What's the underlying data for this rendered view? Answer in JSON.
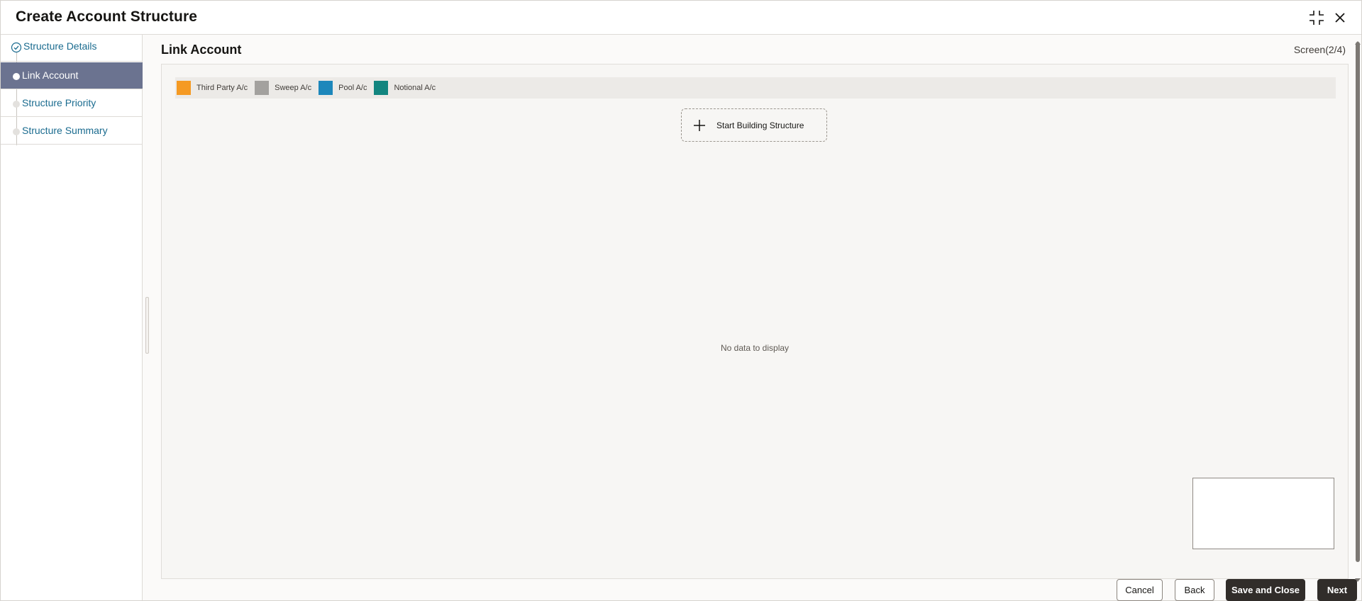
{
  "window": {
    "title": "Create Account Structure"
  },
  "header_icons": {
    "minimize": "minimize-icon",
    "close": "close-icon"
  },
  "sidebar": {
    "steps": [
      {
        "label": "Structure Details",
        "state": "completed"
      },
      {
        "label": "Link Account",
        "state": "active"
      },
      {
        "label": "Structure Priority",
        "state": "pending"
      },
      {
        "label": "Structure Summary",
        "state": "pending"
      }
    ]
  },
  "main": {
    "title": "Link Account",
    "screen_indicator": "Screen(2/4)",
    "legend": [
      {
        "label": "Third Party A/c",
        "color": "#f59a23"
      },
      {
        "label": "Sweep A/c",
        "color": "#a3a19e"
      },
      {
        "label": "Pool A/c",
        "color": "#1d87bb"
      },
      {
        "label": "Notional A/c",
        "color": "#12857f"
      }
    ],
    "start_button_label": "Start Building Structure",
    "empty_message": "No data to display"
  },
  "footer": {
    "cancel_label": "Cancel",
    "back_label": "Back",
    "save_close_label": "Save and Close",
    "next_label": "Next"
  }
}
